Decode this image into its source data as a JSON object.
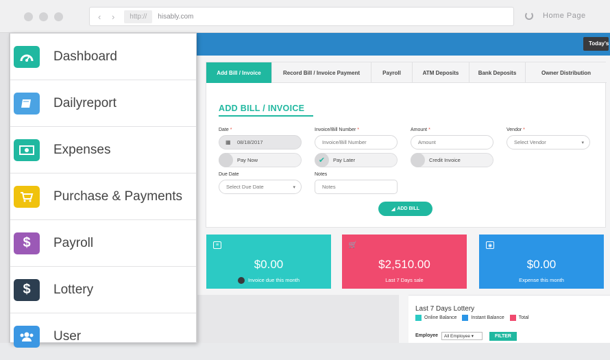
{
  "browser": {
    "nav_arrows": "‹ ›",
    "protocol": "http://",
    "url": "hisably.com",
    "home_label": "Home Page"
  },
  "app": {
    "todays_label": "Today's"
  },
  "menu": {
    "items": [
      {
        "label": "Dashboard",
        "icon": "dashboard-gauge-icon",
        "color": "#20b8a0"
      },
      {
        "label": "Dailyreport",
        "icon": "book-icon",
        "color": "#4ba3e3"
      },
      {
        "label": "Expenses",
        "icon": "money-bill-icon",
        "color": "#20b8a0"
      },
      {
        "label": "Purchase & Payments",
        "icon": "cart-icon",
        "color": "#f0c20d"
      },
      {
        "label": "Payroll",
        "icon": "dollar-icon",
        "color": "#9b59b6"
      },
      {
        "label": "Lottery",
        "icon": "dollar-icon",
        "color": "#2c3e50"
      },
      {
        "label": "User",
        "icon": "users-icon",
        "color": "#3b97e3"
      }
    ]
  },
  "tabs": [
    {
      "label": "Add Bill / Invoice",
      "active": true
    },
    {
      "label": "Record Bill / Invoice Payment",
      "active": false
    },
    {
      "label": "Payroll",
      "active": false
    },
    {
      "label": "ATM Deposits",
      "active": false
    },
    {
      "label": "Bank Deposits",
      "active": false
    },
    {
      "label": "Owner Distribution",
      "active": false
    }
  ],
  "form": {
    "title": "ADD BILL / INVOICE",
    "date_label": "Date",
    "date_value": "08/18/2017",
    "invoice_label": "Invoice/Bill Number",
    "invoice_placeholder": "Invoice/Bill Number",
    "amount_label": "Amount",
    "amount_placeholder": "Amount",
    "vendor_label": "Vendor",
    "vendor_value": "Select Vendor",
    "pay_now": "Pay Now",
    "pay_later": "Pay Later",
    "credit_invoice": "Credit Invoice",
    "due_date_label": "Due Date",
    "due_date_value": "Select Due Date",
    "notes_label": "Notes",
    "notes_placeholder": "Notes",
    "required_mark": "*",
    "add_button": "ADD BILL"
  },
  "stats": [
    {
      "value": "$0.00",
      "caption": "Invoice due this month",
      "color": "#2ccac4"
    },
    {
      "value": "$2,510.00",
      "caption": "Last 7 Days sale",
      "color": "#f04a6e"
    },
    {
      "value": "$0.00",
      "caption": "Expense this month",
      "color": "#2b95e6"
    }
  ],
  "lottery": {
    "title": "Last 7 Days Lottery",
    "legend": [
      {
        "label": "Online Balance",
        "color": "#2ccac4"
      },
      {
        "label": "Instant Balance",
        "color": "#2b95e6"
      },
      {
        "label": "Total",
        "color": "#f04a6e"
      }
    ],
    "employee_label": "Employee",
    "employee_value": "All Employee",
    "filter_label": "FILTER"
  }
}
